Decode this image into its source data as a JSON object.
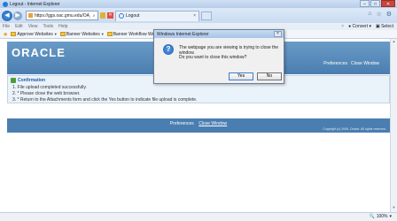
{
  "window": {
    "title": "Logout - Internet Explorer"
  },
  "nav": {
    "url": "https://ggs.oac.gmu.edu/OA_HTML",
    "tab_title": "Logout",
    "tab_close": "×"
  },
  "menubar": {
    "items": [
      "File",
      "Edit",
      "View",
      "Tools",
      "Help"
    ],
    "convert_label": "Convert",
    "select_label": "Select",
    "close_glyph": "×"
  },
  "favorites": {
    "items": [
      {
        "label": "Approve Websites"
      },
      {
        "label": "Banner Websites"
      },
      {
        "label": "Banner Workflow Websites"
      }
    ]
  },
  "page": {
    "logo": "ORACLE",
    "header_links": {
      "preferences": "Preferences",
      "close_window": "Close Window"
    },
    "confirmation": {
      "title": "Confirmation",
      "lines": [
        "1.  File upload completed successfully.",
        "2.  * Please close the web browser.",
        "3.  * Return to the Attachments form and click the Yes button to indicate file upload is complete."
      ]
    },
    "footer": {
      "preferences": "Preferences",
      "close_window": "Close Window",
      "copyright": "Copyright (c) 2006, Oracle. All rights reserved."
    }
  },
  "dialog": {
    "title": "Windows Internet Explorer",
    "message": "The webpage you are viewing is trying to close the window.",
    "question": "Do you want to close this window?",
    "yes_label": "Yes",
    "no_label": "No",
    "close_glyph": "×"
  },
  "status": {
    "zoom": "100%"
  }
}
